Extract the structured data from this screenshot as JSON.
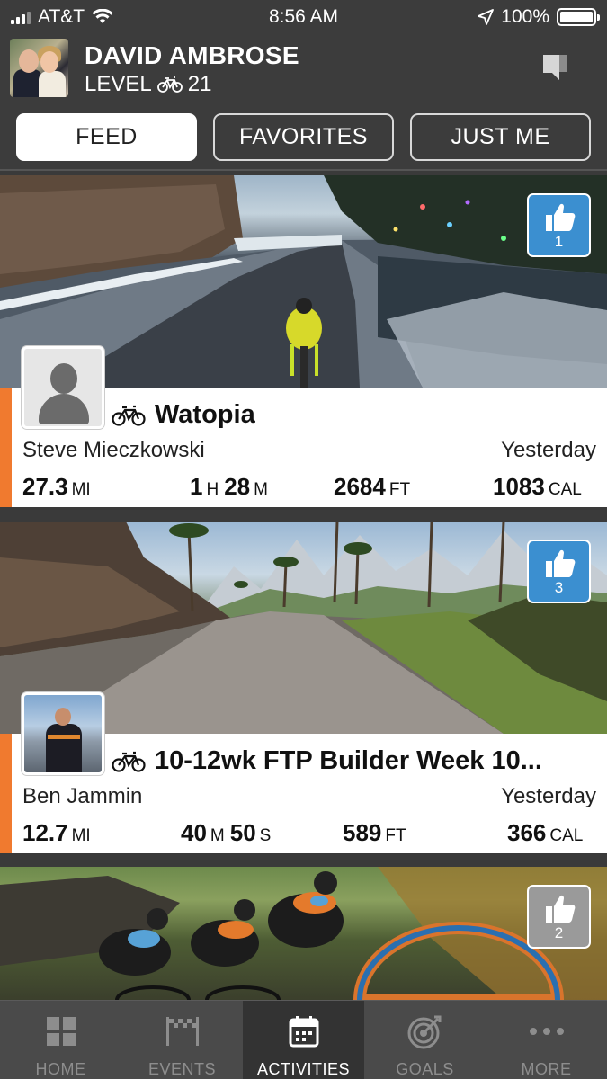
{
  "status_bar": {
    "carrier": "AT&T",
    "time": "8:56 AM",
    "battery": "100%"
  },
  "profile": {
    "name": "DAVID AMBROSE",
    "level_label": "LEVEL",
    "level_value": "21"
  },
  "tabs": [
    {
      "label": "FEED",
      "active": true
    },
    {
      "label": "FAVORITES",
      "active": false
    },
    {
      "label": "JUST ME",
      "active": false
    }
  ],
  "feed": [
    {
      "title": "Watopia",
      "rider": "Steve Mieczkowski",
      "date": "Yesterday",
      "likes": "1",
      "like_style": "blue",
      "avatar": "default-person-icon",
      "stats": [
        {
          "value": "27.3",
          "unit": "MI"
        },
        {
          "value": "1",
          "unit": "H",
          "value2": "28",
          "unit2": "M"
        },
        {
          "value": "2684",
          "unit": "FT"
        },
        {
          "value": "1083",
          "unit": "CAL"
        }
      ]
    },
    {
      "title": "10-12wk FTP Builder Week 10...",
      "rider": "Ben Jammin",
      "date": "Yesterday",
      "likes": "3",
      "like_style": "blue",
      "avatar": "rider-photo",
      "stats": [
        {
          "value": "12.7",
          "unit": "MI"
        },
        {
          "value": "40",
          "unit": "M",
          "value2": "50",
          "unit2": "S"
        },
        {
          "value": "589",
          "unit": "FT"
        },
        {
          "value": "366",
          "unit": "CAL"
        }
      ]
    },
    {
      "likes": "2",
      "like_style": "grey"
    }
  ],
  "nav": [
    {
      "label": "HOME",
      "icon": "grid-icon",
      "active": false
    },
    {
      "label": "EVENTS",
      "icon": "checkered-flag-icon",
      "active": false
    },
    {
      "label": "ACTIVITIES",
      "icon": "calendar-icon",
      "active": true
    },
    {
      "label": "GOALS",
      "icon": "target-icon",
      "active": false
    },
    {
      "label": "MORE",
      "icon": "more-dots-icon",
      "active": false
    }
  ],
  "colors": {
    "accent": "#f07a2f",
    "like_blue": "#3b8fd0",
    "like_grey": "#9a9a9a"
  }
}
